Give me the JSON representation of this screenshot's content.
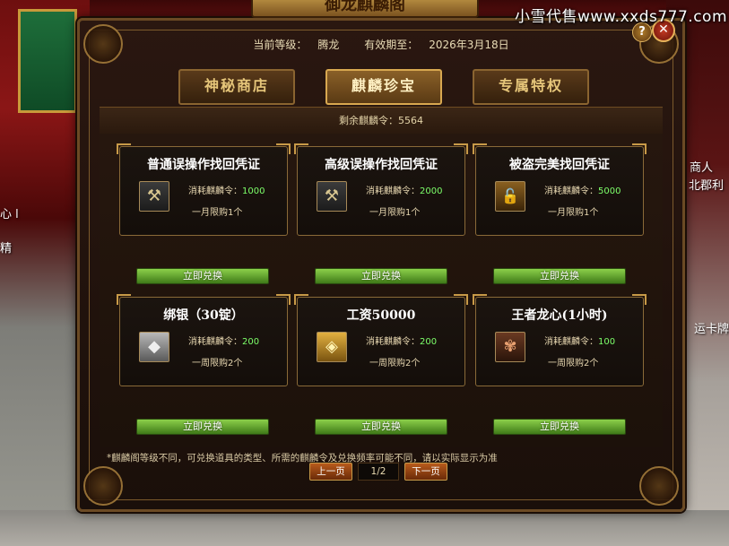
{
  "watermark": "小雪代售www.xxds777.com",
  "window_title": "御龙麒麟阁",
  "header": {
    "level_label": "当前等级：",
    "level_value": "腾龙",
    "expiry_label": "有效期至：",
    "expiry_value": "2026年3月18日"
  },
  "tabs": [
    {
      "label": "神秘商店",
      "active": false
    },
    {
      "label": "麒麟珍宝",
      "active": true
    },
    {
      "label": "专属特权",
      "active": false
    }
  ],
  "remaining": "剩余麒麟令：5564",
  "cost_label": "消耗麒麟令：",
  "exchange_label": "立即兑换",
  "items": [
    {
      "name": "普通误操作找回凭证",
      "cost": "1000",
      "limit": "一月限购1个",
      "icon": "hammer-icon",
      "glyph": "⚒"
    },
    {
      "name": "高级误操作找回凭证",
      "cost": "2000",
      "limit": "一月限购1个",
      "icon": "hammer-icon",
      "glyph": "⚒"
    },
    {
      "name": "被盗完美找回凭证",
      "cost": "5000",
      "limit": "一月限购1个",
      "icon": "lock-icon",
      "glyph": "🔓"
    },
    {
      "name": "绑银（30锭）",
      "cost": "200",
      "limit": "一周限购2个",
      "icon": "silver-ingot-icon",
      "glyph": "◆"
    },
    {
      "name": "工资50000",
      "cost": "200",
      "limit": "一周限购2个",
      "icon": "gold-ingot-icon",
      "glyph": "◈"
    },
    {
      "name": "王者龙心(1小时)",
      "cost": "100",
      "limit": "一周限购2个",
      "icon": "dragon-icon",
      "glyph": "✾"
    }
  ],
  "note": "*麒麟阁等级不同，可兑换道具的类型、所需的麒麟令及兑换频率可能不同，请以实际显示为准",
  "pager": {
    "prev": "上一页",
    "page": "1/2",
    "next": "下一页"
  },
  "side_texts": {
    "left_1": "心 l",
    "left_2": "精",
    "right_1": "商人",
    "right_2": "北郡利",
    "right_3": "运卡牌"
  },
  "help_label": "?",
  "close_label": "✕"
}
